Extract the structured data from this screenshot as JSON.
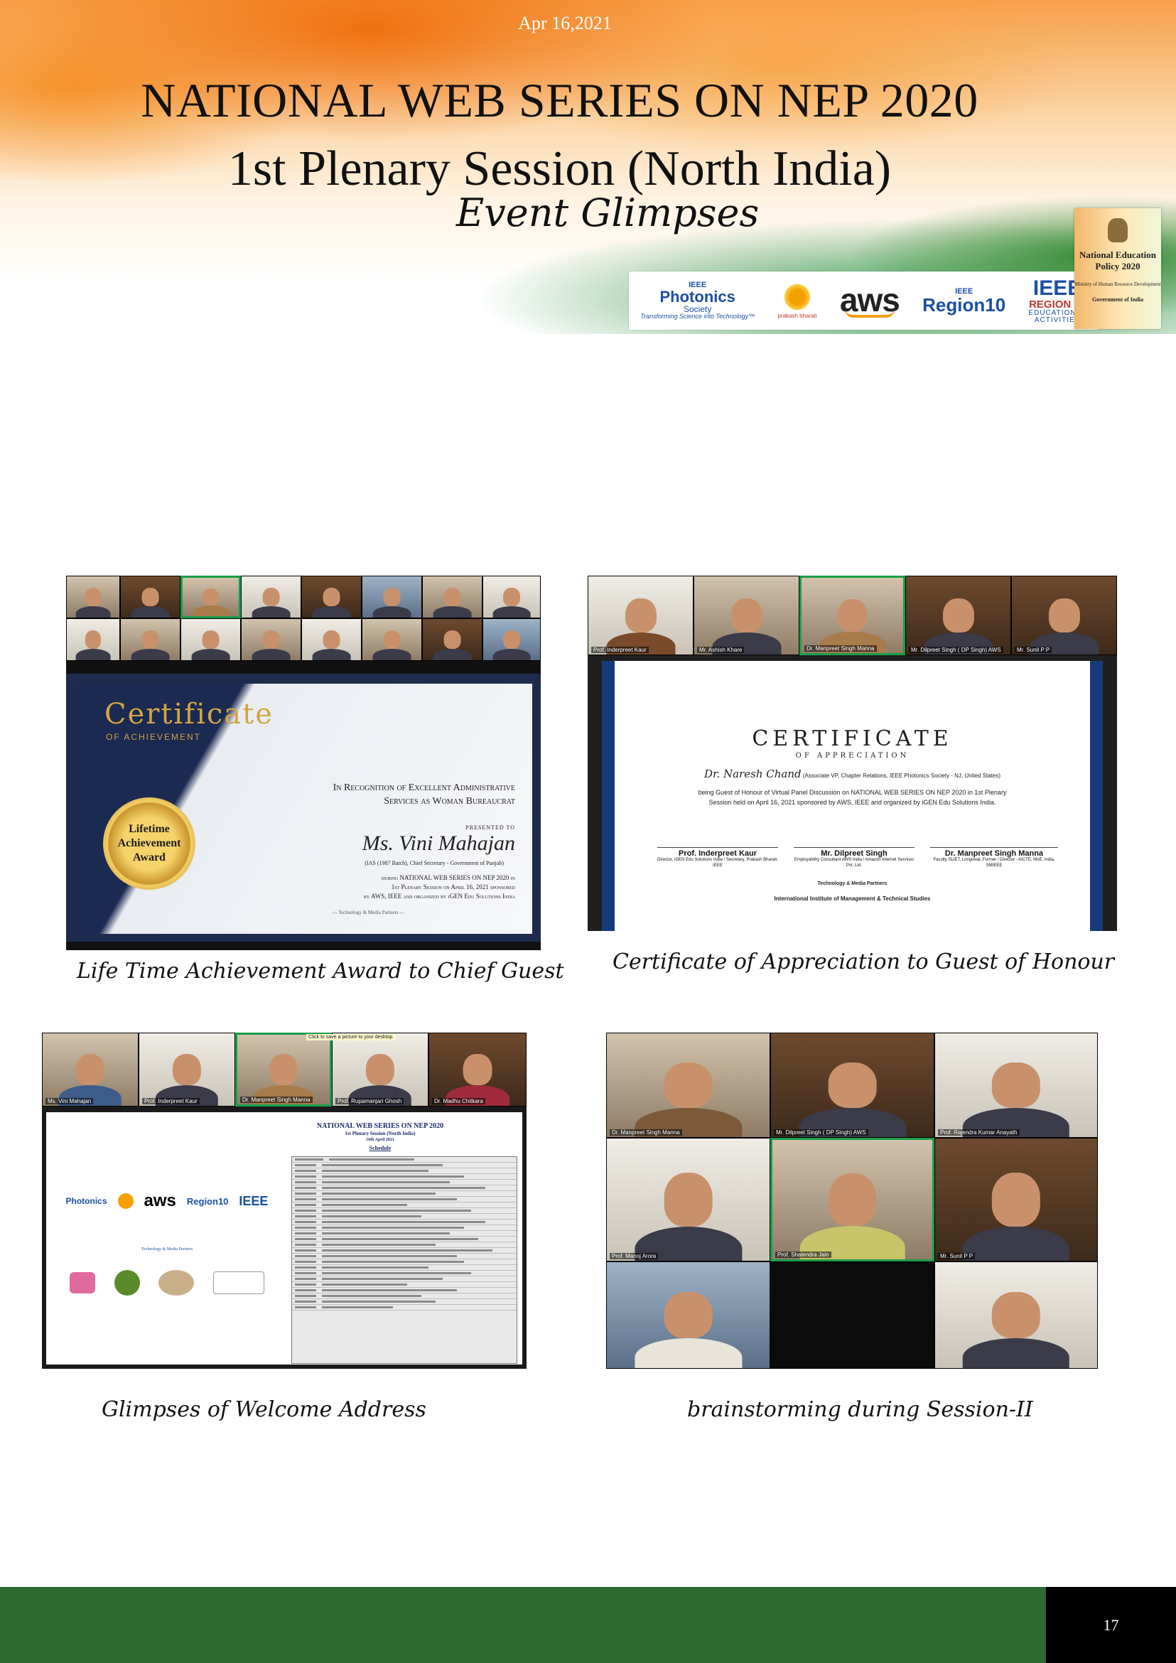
{
  "header": {
    "date": "Apr 16,2021",
    "title_line1": "NATIONAL WEB SERIES ON NEP 2020",
    "title_line2": "1st Plenary Session (North India)",
    "subtitle": "Event Glimpses"
  },
  "partners": {
    "photonics_ieee": "IEEE",
    "photonics_name": "Photonics",
    "photonics_society": "Society",
    "photonics_tagline": "Transforming Science into Technology™",
    "prakash_bharati": "prakash bharati",
    "aws": "aws",
    "region10_ieee": "IEEE",
    "region10_name": "Region10",
    "ieee_r10_edu_ieee": "IEEE",
    "ieee_r10_edu_region": "REGION 10",
    "ieee_r10_edu_line1": "EDUCATIONAL",
    "ieee_r10_edu_line2": "ACTIVITIES"
  },
  "nep_badge": {
    "title": "National Education Policy 2020",
    "ministry": "Ministry of Human Resource Development",
    "government": "Government of India"
  },
  "photos": {
    "photo1": {
      "certificate_heading": "Certificate",
      "certificate_sub": "OF ACHIEVEMENT",
      "medal_text": "Lifetime Achievement Award",
      "recognition": "In Recognition of Excellent Administrative Services as Woman Bureaucrat",
      "presented_to": "PRESENTED TO",
      "recipient": "Ms. Vini Mahajan",
      "recipient_detail": "(IAS (1987 Batch), Chief Secretary - Government of Punjab)",
      "event_line1": "during NATIONAL WEB SERIES ON NEP 2020 in",
      "event_line2": "1st Plenary Session on April 16, 2021 sponsored",
      "event_line3": "by AWS, IEEE and organized by iGEN Edu Solutions India",
      "partners_label": "-:- Technology & Media Partners -:-"
    },
    "photo2": {
      "labels": [
        "Prof. Inderpreet Kaur",
        "Mr. Ashish Khare",
        "Dr. Manpreet Singh Manna",
        "Mr. Dilpreet Singh ( DP Singh) AWS",
        "Mr. Sunil P P"
      ],
      "cert_title": "CERTIFICATE",
      "cert_sub": "OF APPRECIATION",
      "recipient": "Dr. Naresh Chand",
      "recipient_detail": "(Associate VP, Chapter Relations, IEEE Photonics Society - NJ, United States)",
      "body_line1": "being Guest of Honour of Virtual Panel Discussion on NATIONAL WEB SERIES ON NEP 2020 in 1st Plenary",
      "body_line2": "Session held on April 16, 2021 sponsored by AWS, IEEE and organized by iGEN Edu Solutions India.",
      "sig1_name": "Prof. Inderpreet Kaur",
      "sig1_desc": "Director, iGEN Edu Solutions India / Secretary, Prakash Bharati, IEEE",
      "sig2_name": "Mr. Dilpreet Singh",
      "sig2_desc": "Employability Consultant AWS India / Amazon Internet Services Pvt. Ltd.",
      "sig3_name": "Dr. Manpreet Singh Manna",
      "sig3_desc": "Faculty SLIET, Longowal, Former / Director - AICTE, MoE, India, SMIEEE",
      "partners_label": "Technology & Media Partners",
      "iimts": "International Institute of Management & Technical Studies"
    },
    "photo3": {
      "labels": [
        "Ms. Vini Mahajan",
        "Prof. Inderpreet Kaur",
        "Dr. Manpreet Singh Manna",
        "Prof. Rupamanjari Ghosh",
        "Dr. Madhu Chitkara"
      ],
      "tooltip": "Click to save a picture to your desktop.",
      "slide_title": "NATIONAL WEB SERIES ON NEP 2020",
      "slide_sub": "1st Plenary Session (North India)",
      "slide_date": "16th April 2021",
      "slide_schedule": "Schedule",
      "partners_label": "Technology & Media Partners"
    },
    "photo4": {
      "labels": [
        "Dr. Manpreet Singh Manna",
        "Mr. Dilpreet Singh ( DP Singh) AWS",
        "Prof. Rajendra Kumar Anayath",
        "Prof. Manoj Arora",
        "Prof. Shalendra Jain",
        "Mr. Sunil P P"
      ]
    }
  },
  "captions": {
    "c1": "Life Time Achievement Award to Chief Guest",
    "c2": "Certificate of Appreciation to Guest of Honour",
    "c3": "Glimpses of Welcome Address",
    "c4": "brainstorming during Session-II"
  },
  "footer": {
    "page_number": "17"
  },
  "colors": {
    "saffron": "#f07a12",
    "green": "#2d6a32",
    "footer_black": "#000000"
  }
}
